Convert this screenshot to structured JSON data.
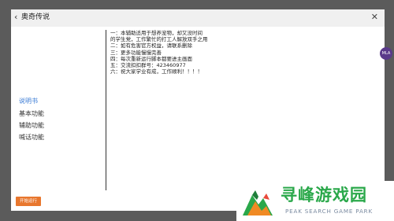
{
  "dialog": {
    "title": "奥奇传说",
    "back_icon": "‹",
    "close_icon": "✕"
  },
  "sidebar": {
    "items": [
      {
        "label": "说明书",
        "active": true
      },
      {
        "label": "基本功能",
        "active": false
      },
      {
        "label": "辅助功能",
        "active": false
      },
      {
        "label": "喊话功能",
        "active": false
      }
    ]
  },
  "content": {
    "lines": [
      "一：本辅助适用于想养宠物，却又没时间",
      "的学生党，工作繁忙的打工人解放双手之用",
      "二：如有危害官方权益，请联系删除",
      "三：更多功能慢慢完善",
      "四：每次重新运行脚本都要进主画面",
      "五：交流扣扣群号：423460977",
      "六：祝大家学业有成，工作顺利！！！！"
    ]
  },
  "footer": {
    "start_label": "开始运行"
  },
  "fab": {
    "label": "MLA"
  },
  "watermark": {
    "title": "寻峰游戏园",
    "subtitle": "PEAK SEARCH GAME PARK"
  },
  "colors": {
    "accent": "#3a7bd5",
    "button": "#e8772e",
    "watermark_green": "#2aa84a"
  }
}
